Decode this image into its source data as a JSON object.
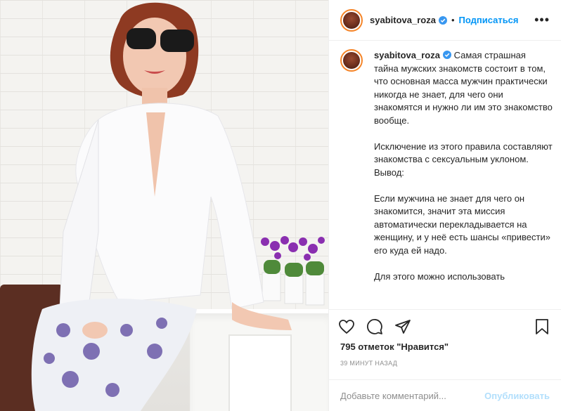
{
  "header": {
    "username": "syabitova_roza",
    "separator": "•",
    "follow_label": "Подписаться",
    "more_label": "•••"
  },
  "caption": {
    "username": "syabitova_roza",
    "text": "Самая страшная тайна мужских знакомств состоит в том, что основная масса мужчин практически никогда не знает, для чего они знакомятся и нужно ли им это знакомство вообще.\n\nИсключение из этого правила составляют знакомства с сексуальным уклоном.\nВывод:\n\nЕсли мужчина не знает для чего он знакомится, значит эта миссия автоматически перекладывается на женщину, и у неё есть шансы «привести» его куда ей надо.\n\nДля этого можно использовать"
  },
  "likes": "795 отметок \"Нравится\"",
  "timestamp": "39 МИНУТ НАЗАД",
  "comment": {
    "placeholder": "Добавьте комментарий...",
    "publish_label": "Опубликовать"
  },
  "icons": {
    "verified": "verified-badge-icon",
    "like": "heart-icon",
    "comment": "comment-bubble-icon",
    "share": "paper-plane-icon",
    "save": "bookmark-icon",
    "more": "ellipsis-icon"
  },
  "colors": {
    "accent": "#0095f6",
    "publish_disabled": "#b2dffc",
    "muted": "#8e8e8e",
    "border": "#efefef"
  }
}
